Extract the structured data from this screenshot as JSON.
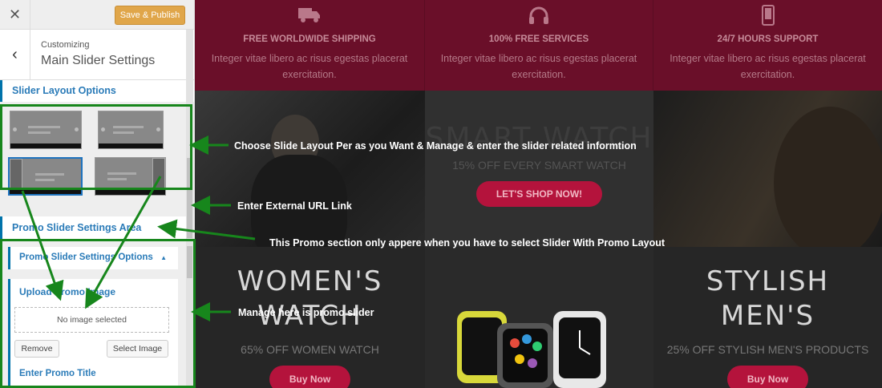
{
  "sidebar": {
    "close_icon": "close-icon",
    "save_label": "Save & Publish",
    "customizing_label": "Customizing",
    "section_title": "Main Slider Settings",
    "layout_heading": "Slider Layout Options",
    "promo_area_heading": "Promo Slider Settings Area",
    "promo_options_heading": "Promo Slider Settings Options",
    "upload_label": "Upload Promo Image",
    "no_image_text": "No image selected",
    "remove_label": "Remove",
    "select_image_label": "Select Image",
    "promo_title_label": "Enter Promo Title"
  },
  "preview": {
    "features": [
      {
        "icon": "truck-icon",
        "title": "FREE WORLDWIDE SHIPPING",
        "desc": "Integer vitae libero ac risus egestas placerat exercitation."
      },
      {
        "icon": "headphones-icon",
        "title": "100% FREE SERVICES",
        "desc": "Integer vitae libero ac risus egestas placerat exercitation."
      },
      {
        "icon": "phone-icon",
        "title": "24/7 HOURS SUPPORT",
        "desc": "Integer vitae libero ac risus egestas placerat exercitation."
      }
    ],
    "smart_watch": {
      "title": "SMART WATCH",
      "subtitle": "15% OFF EVERY SMART WATCH",
      "cta": "LET'S SHOP NOW!"
    },
    "women": {
      "title_line1": "WOMEN'S",
      "title_line2": "WATCH",
      "subtitle": "65% OFF WOMEN WATCH",
      "cta": "Buy Now"
    },
    "men": {
      "title_line1": "STYLISH",
      "title_line2": "MEN'S",
      "subtitle": "25% OFF STYLISH MEN'S PRODUCTS",
      "cta": "Buy Now"
    }
  },
  "annotations": {
    "layout_note": "Choose Slide Layout Per as you Want & Manage & enter the slider related informtion",
    "url_note": "Enter External URL Link",
    "promo_note": "This Promo section only appere when you have to select Slider With Promo Layout",
    "manage_note": "Manage here is promo slider",
    "arrow_color": "#17861c"
  }
}
